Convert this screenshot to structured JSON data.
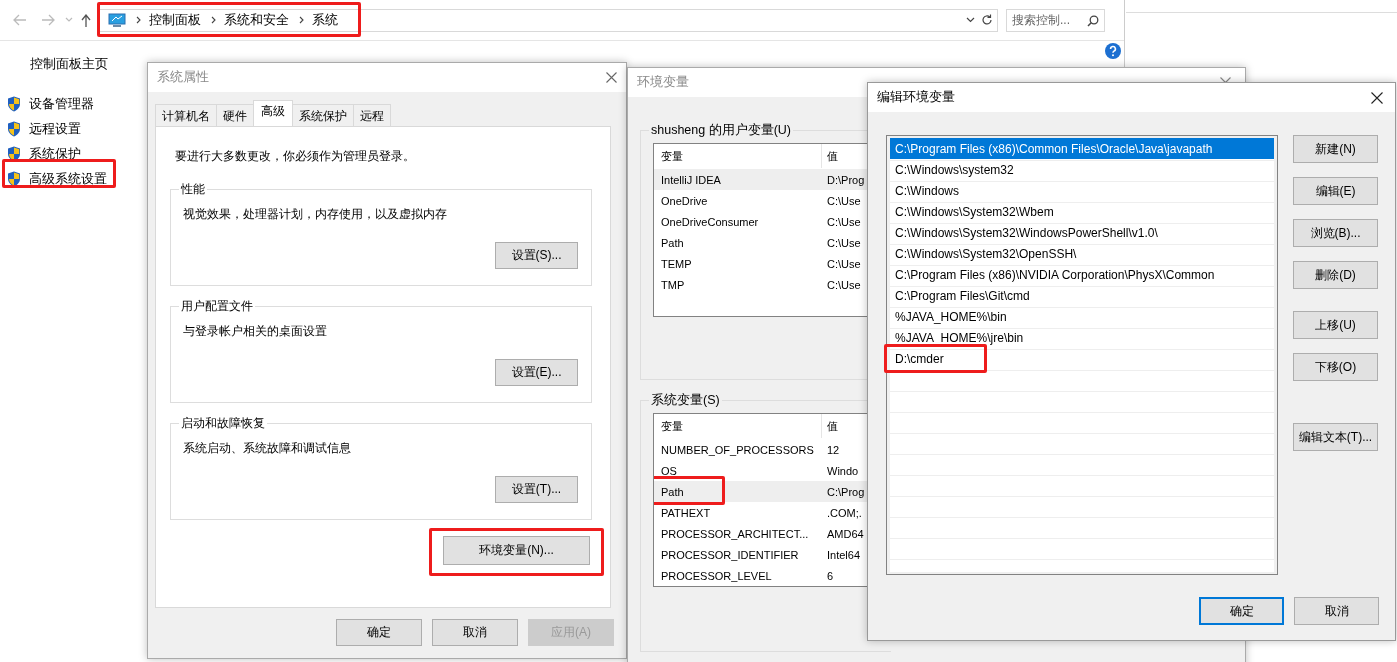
{
  "explorer": {
    "breadcrumbs": [
      "控制面板",
      "系统和安全",
      "系统"
    ],
    "breadcrumbs_highlighted": true,
    "search": {
      "placeholder": "搜索控制..."
    },
    "sidebar": {
      "home": "控制面板主页",
      "items": [
        {
          "label": "设备管理器",
          "highlighted": false
        },
        {
          "label": "远程设置",
          "highlighted": false
        },
        {
          "label": "系统保护",
          "highlighted": false
        },
        {
          "label": "高级系统设置",
          "highlighted": true
        }
      ]
    }
  },
  "system_properties": {
    "title": "系统属性",
    "tabs": [
      {
        "label": "计算机名",
        "selected": false
      },
      {
        "label": "硬件",
        "selected": false
      },
      {
        "label": "高级",
        "selected": true
      },
      {
        "label": "系统保护",
        "selected": false
      },
      {
        "label": "远程",
        "selected": false
      }
    ],
    "notice": "要进行大多数更改，你必须作为管理员登录。",
    "groups": [
      {
        "title": "性能",
        "description": "视觉效果，处理器计划，内存使用，以及虚拟内存",
        "button": "设置(S)..."
      },
      {
        "title": "用户配置文件",
        "description": "与登录帐户相关的桌面设置",
        "button": "设置(E)..."
      },
      {
        "title": "启动和故障恢复",
        "description": "系统启动、系统故障和调试信息",
        "button": "设置(T)..."
      }
    ],
    "env_button": {
      "label": "环境变量(N)...",
      "highlighted": true
    },
    "buttons": [
      {
        "label": "确定",
        "disabled": false
      },
      {
        "label": "取消",
        "disabled": false
      },
      {
        "label": "应用(A)",
        "disabled": true
      }
    ]
  },
  "environment_variables": {
    "title": "环境变量",
    "user_group": {
      "title": "shusheng 的用户变量(U)",
      "columns": [
        "变量",
        "值"
      ],
      "rows": [
        {
          "name": "IntelliJ IDEA",
          "value": "D:\\Prog",
          "selected": true,
          "highlighted": false
        },
        {
          "name": "OneDrive",
          "value": "C:\\Use",
          "selected": false,
          "highlighted": false
        },
        {
          "name": "OneDriveConsumer",
          "value": "C:\\Use",
          "selected": false,
          "highlighted": false
        },
        {
          "name": "Path",
          "value": "C:\\Use",
          "selected": false,
          "highlighted": false
        },
        {
          "name": "TEMP",
          "value": "C:\\Use",
          "selected": false,
          "highlighted": false
        },
        {
          "name": "TMP",
          "value": "C:\\Use",
          "selected": false,
          "highlighted": false
        }
      ]
    },
    "system_group": {
      "title": "系统变量(S)",
      "columns": [
        "变量",
        "值"
      ],
      "rows": [
        {
          "name": "NUMBER_OF_PROCESSORS",
          "value": "12",
          "selected": false,
          "highlighted": false
        },
        {
          "name": "OS",
          "value": "Windo",
          "selected": false,
          "highlighted": false
        },
        {
          "name": "Path",
          "value": "C:\\Prog",
          "selected": true,
          "highlighted": true
        },
        {
          "name": "PATHEXT",
          "value": ".COM;.",
          "selected": false,
          "highlighted": false
        },
        {
          "name": "PROCESSOR_ARCHITECT...",
          "value": "AMD64",
          "selected": false,
          "highlighted": false
        },
        {
          "name": "PROCESSOR_IDENTIFIER",
          "value": "Intel64",
          "selected": false,
          "highlighted": false
        },
        {
          "name": "PROCESSOR_LEVEL",
          "value": "6",
          "selected": false,
          "highlighted": false
        }
      ]
    }
  },
  "edit_dialog": {
    "title": "编辑环境变量",
    "entries": [
      {
        "text": "C:\\Program Files (x86)\\Common Files\\Oracle\\Java\\javapath",
        "selected": true,
        "highlighted": false
      },
      {
        "text": "C:\\Windows\\system32",
        "selected": false,
        "highlighted": false
      },
      {
        "text": "C:\\Windows",
        "selected": false,
        "highlighted": false
      },
      {
        "text": "C:\\Windows\\System32\\Wbem",
        "selected": false,
        "highlighted": false
      },
      {
        "text": "C:\\Windows\\System32\\WindowsPowerShell\\v1.0\\",
        "selected": false,
        "highlighted": false
      },
      {
        "text": "C:\\Windows\\System32\\OpenSSH\\",
        "selected": false,
        "highlighted": false
      },
      {
        "text": "C:\\Program Files (x86)\\NVIDIA Corporation\\PhysX\\Common",
        "selected": false,
        "highlighted": false
      },
      {
        "text": "C:\\Program Files\\Git\\cmd",
        "selected": false,
        "highlighted": false
      },
      {
        "text": "%JAVA_HOME%\\bin",
        "selected": false,
        "highlighted": false
      },
      {
        "text": "%JAVA_HOME%\\jre\\bin",
        "selected": false,
        "highlighted": false
      },
      {
        "text": "D:\\cmder",
        "selected": false,
        "highlighted": true
      }
    ],
    "side_buttons": [
      [
        "新建(N)",
        "编辑(E)",
        "浏览(B)...",
        "删除(D)"
      ],
      [
        "上移(U)",
        "下移(O)"
      ],
      [
        "编辑文本(T)..."
      ]
    ],
    "buttons": [
      "确定",
      "取消"
    ]
  }
}
